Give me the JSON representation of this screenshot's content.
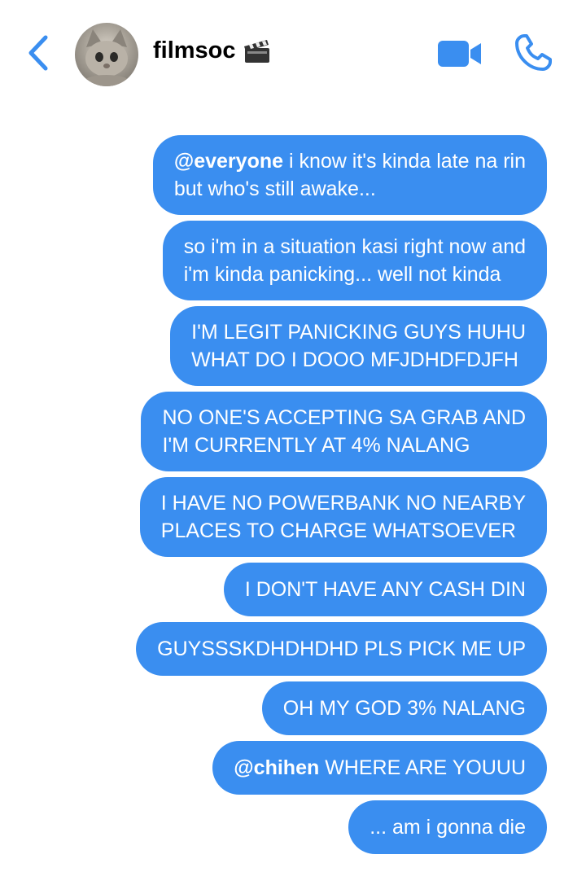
{
  "header": {
    "chat_name": "filmsoc",
    "back_icon": "chevron-left-icon",
    "name_emoji_icon": "clapperboard-icon",
    "video_icon": "video-camera-icon",
    "phone_icon": "phone-icon",
    "accent_color": "#3a8ef0"
  },
  "messages": [
    {
      "mention": "@everyone",
      "line1": " i know it's kinda late na rin",
      "line2": "but who's still awake..."
    },
    {
      "line1": "so i'm in a situation kasi right now and",
      "line2": "i'm kinda panicking... well not kinda"
    },
    {
      "line1": "I'M LEGIT PANICKING GUYS HUHU",
      "line2": "WHAT DO I DOOO MFJDHDFDJFH"
    },
    {
      "line1": "NO ONE'S ACCEPTING SA GRAB AND",
      "line2": "I'M CURRENTLY AT 4% NALANG"
    },
    {
      "line1": "I HAVE NO POWERBANK NO NEARBY",
      "line2": "PLACES TO CHARGE WHATSOEVER"
    },
    {
      "line1": "I DON'T HAVE ANY CASH DIN"
    },
    {
      "line1": "GUYSSSKDHDHDHD PLS PICK ME UP"
    },
    {
      "line1": "OH MY GOD 3% NALANG"
    },
    {
      "mention": "@chihen",
      "line1": " WHERE ARE YOUUU"
    },
    {
      "line1": "... am i gonna die"
    }
  ]
}
